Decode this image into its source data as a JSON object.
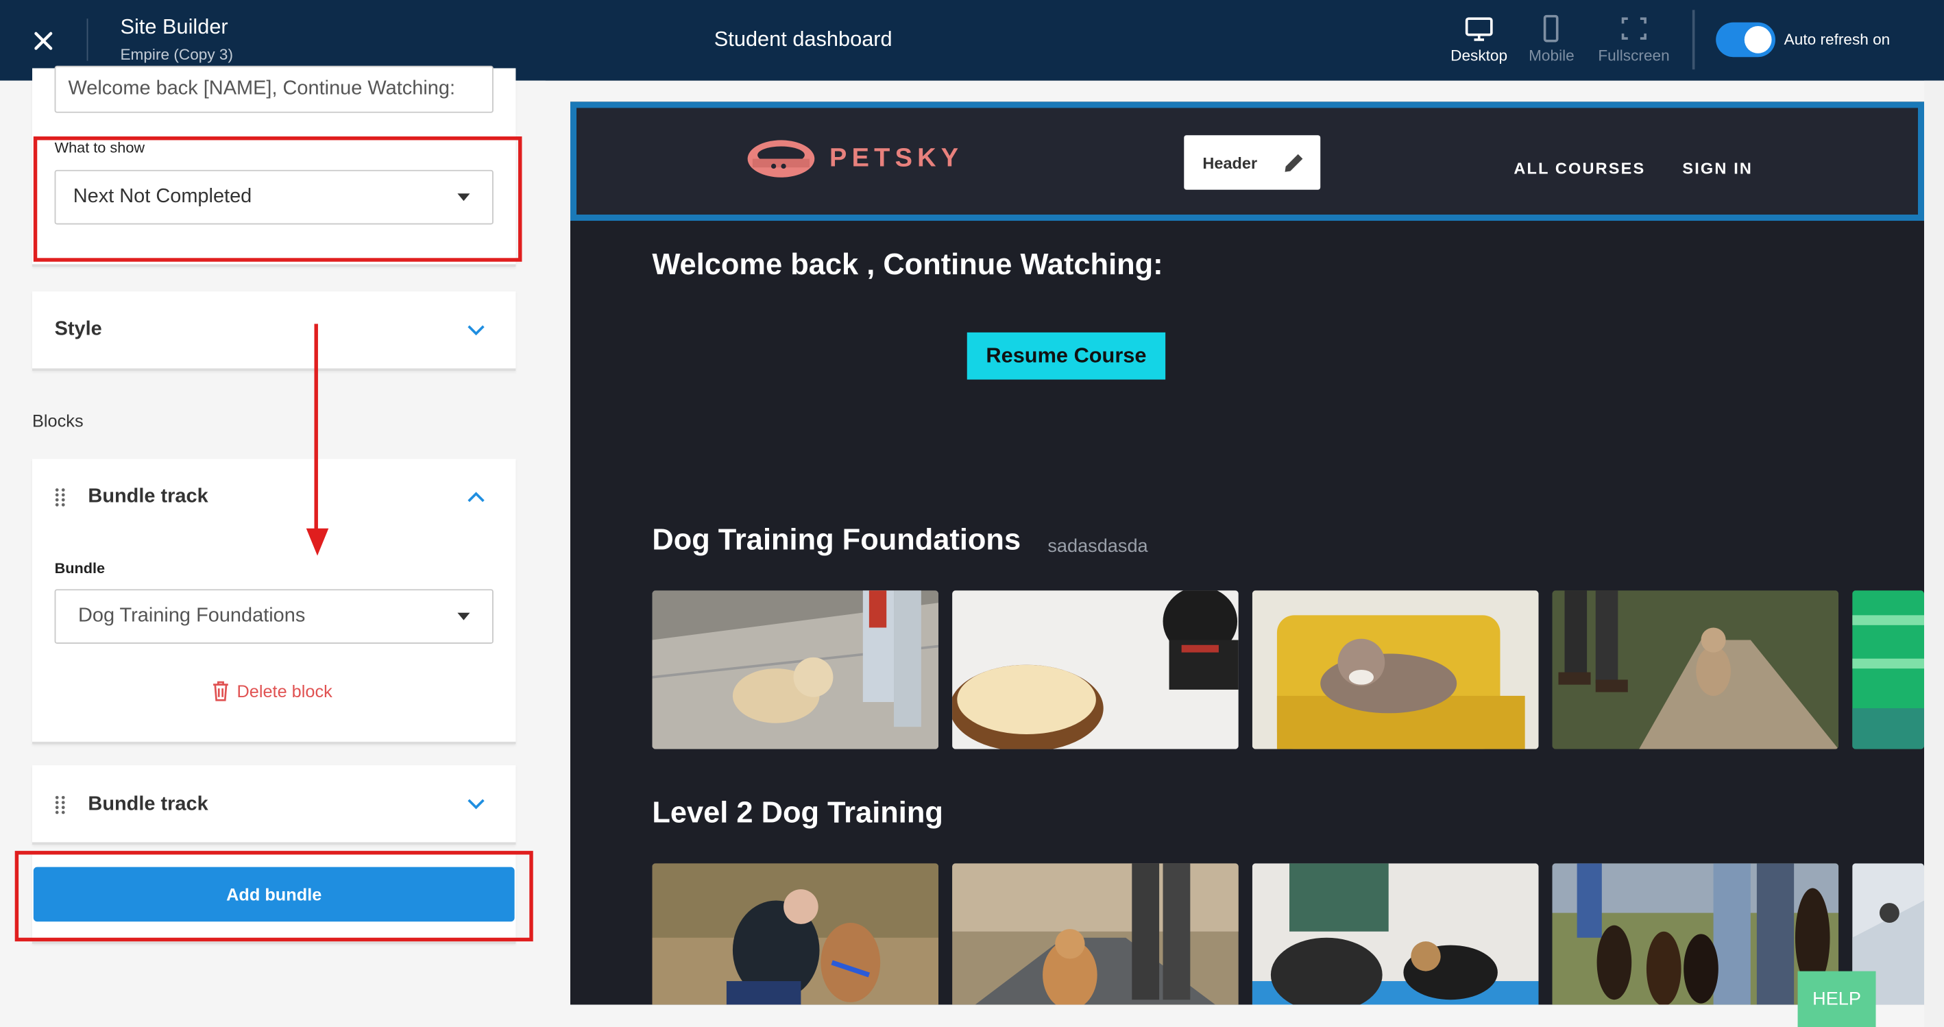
{
  "topbar": {
    "app_title": "Site Builder",
    "app_subtitle": "Empire (Copy 3)",
    "page_title": "Student dashboard",
    "views": [
      {
        "label": "Desktop",
        "icon": "desktop-icon",
        "active": true
      },
      {
        "label": "Mobile",
        "icon": "mobile-icon",
        "active": false
      },
      {
        "label": "Fullscreen",
        "icon": "fullscreen-icon",
        "active": false
      }
    ],
    "auto_refresh_label": "Auto refresh on",
    "auto_refresh_on": true
  },
  "sidebar": {
    "welcome_input_value": "Welcome back [NAME], Continue Watching:",
    "what_to_show_label": "What to show",
    "what_to_show_value": "Next Not Completed",
    "style_label": "Style",
    "blocks_label": "Blocks",
    "blocks": [
      {
        "title": "Bundle track",
        "expanded": true,
        "bundle_label": "Bundle",
        "bundle_value": "Dog Training Foundations",
        "delete_label": "Delete block"
      },
      {
        "title": "Bundle track",
        "expanded": false
      }
    ],
    "add_bundle_label": "Add bundle"
  },
  "preview": {
    "logo_text": "PETSKY",
    "header_chip_label": "Header",
    "nav": [
      "ALL COURSES",
      "SIGN IN"
    ],
    "welcome_heading": "Welcome back , Continue Watching:",
    "resume_label": "Resume Course",
    "tracks": [
      {
        "title": "Dog Training Foundations",
        "subtitle": "sadasdasda"
      },
      {
        "title": "Level 2 Dog Training",
        "subtitle": ""
      }
    ]
  },
  "help_label": "HELP",
  "colors": {
    "topbar": "#0d2b4a",
    "accent": "#1f8ee0",
    "resume": "#14d4e6",
    "annotation": "#e01e1e",
    "help": "#5ecf95"
  }
}
